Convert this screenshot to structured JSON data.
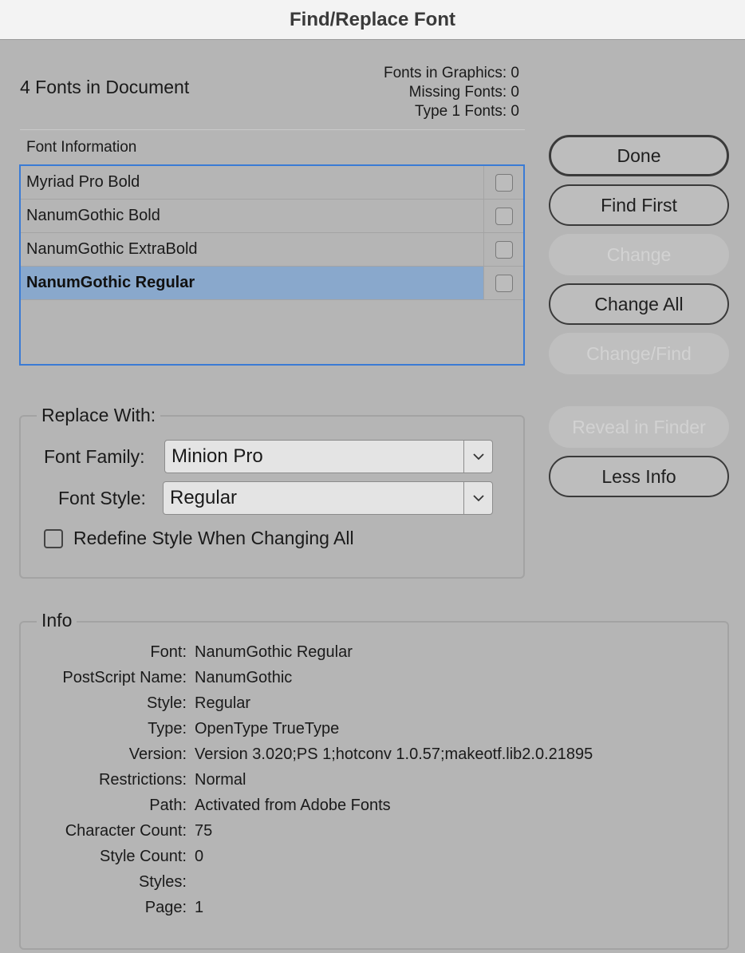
{
  "window": {
    "title": "Find/Replace Font"
  },
  "summary": {
    "fonts_in_document": "4 Fonts in Document",
    "fonts_in_graphics": "Fonts in Graphics: 0",
    "missing_fonts": "Missing Fonts: 0",
    "type1_fonts": "Type 1 Fonts: 0"
  },
  "font_info": {
    "label": "Font Information",
    "fonts": [
      {
        "name": "Myriad Pro Bold"
      },
      {
        "name": "NanumGothic Bold"
      },
      {
        "name": "NanumGothic ExtraBold"
      },
      {
        "name": "NanumGothic Regular"
      }
    ],
    "selected_index": 3
  },
  "buttons": {
    "done": "Done",
    "find_first": "Find First",
    "change": "Change",
    "change_all": "Change All",
    "change_find": "Change/Find",
    "reveal": "Reveal in Finder",
    "less_info": "Less Info"
  },
  "replace": {
    "legend": "Replace With:",
    "family_label": "Font Family:",
    "family_value": "Minion Pro",
    "style_label": "Font Style:",
    "style_value": "Regular",
    "redefine_label": "Redefine Style When Changing All",
    "redefine_checked": false
  },
  "info": {
    "legend": "Info",
    "rows": [
      {
        "k": "Font:",
        "v": "NanumGothic Regular"
      },
      {
        "k": "PostScript Name:",
        "v": "NanumGothic"
      },
      {
        "k": "Style:",
        "v": "Regular"
      },
      {
        "k": "Type:",
        "v": "OpenType TrueType"
      },
      {
        "k": "Version:",
        "v": "Version 3.020;PS 1;hotconv 1.0.57;makeotf.lib2.0.21895"
      },
      {
        "k": "Restrictions:",
        "v": "Normal"
      },
      {
        "k": "Path:",
        "v": "Activated from Adobe Fonts"
      },
      {
        "k": "Character Count:",
        "v": "75"
      },
      {
        "k": "Style Count:",
        "v": "0"
      },
      {
        "k": "Styles:",
        "v": ""
      },
      {
        "k": "Page:",
        "v": "1"
      }
    ]
  }
}
